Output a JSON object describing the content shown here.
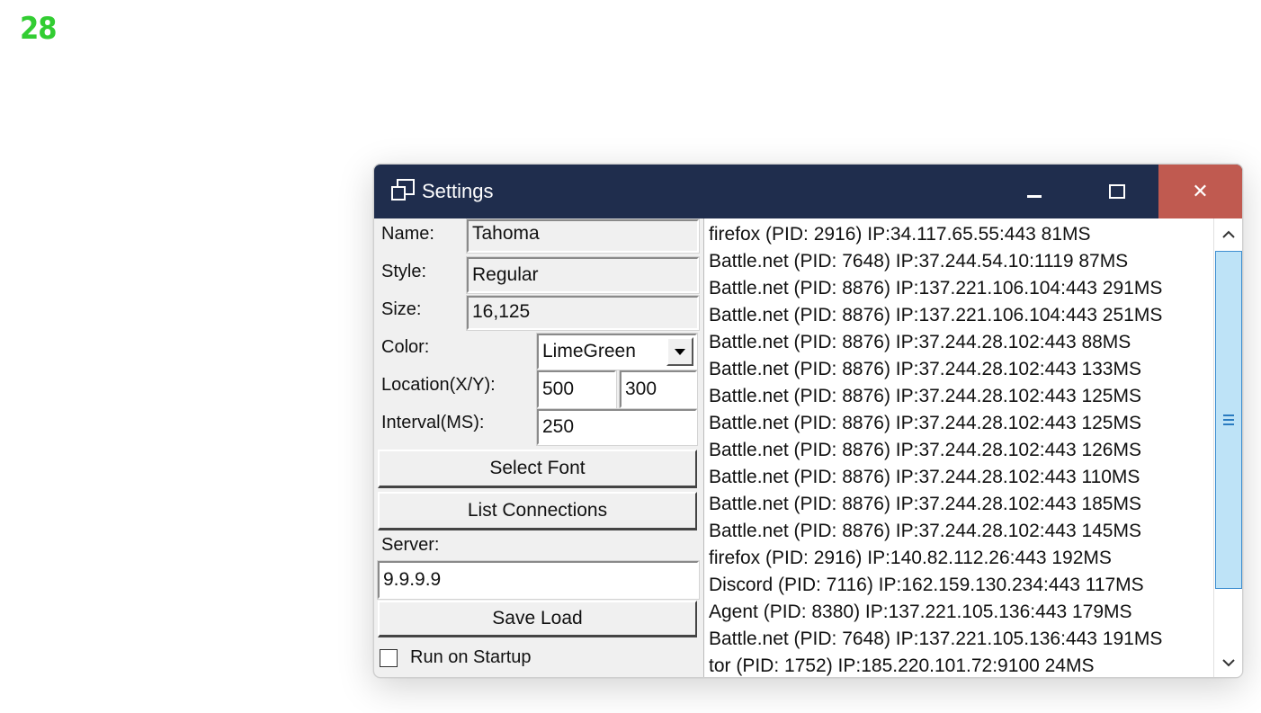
{
  "overlay_value": "28",
  "window": {
    "title": "Settings",
    "controls": {
      "minimize": "minimize-icon",
      "maximize": "maximize-icon",
      "close": "✕"
    }
  },
  "form": {
    "name_label": "Name:",
    "name_value": "Tahoma",
    "style_label": "Style:",
    "style_value": "Regular",
    "size_label": "Size:",
    "size_value": "16,125",
    "color_label": "Color:",
    "color_value": "LimeGreen",
    "location_label": "Location(X/Y):",
    "location_x": "500",
    "location_y": "300",
    "interval_label": "Interval(MS):",
    "interval_value": "250",
    "select_font_button": "Select Font",
    "list_connections_button": "List Connections",
    "server_label": "Server:",
    "server_value": "9.9.9.9",
    "save_load_button": "Save  Load",
    "run_on_startup_label": "Run on Startup",
    "run_on_startup_checked": false
  },
  "connections": [
    "firefox (PID: 2916) IP:34.117.65.55:443 81MS",
    "Battle.net (PID: 7648) IP:37.244.54.10:1119 87MS",
    "Battle.net (PID: 8876) IP:137.221.106.104:443 291MS",
    "Battle.net (PID: 8876) IP:137.221.106.104:443 251MS",
    "Battle.net (PID: 8876) IP:37.244.28.102:443 88MS",
    "Battle.net (PID: 8876) IP:37.244.28.102:443 133MS",
    "Battle.net (PID: 8876) IP:37.244.28.102:443 125MS",
    "Battle.net (PID: 8876) IP:37.244.28.102:443 125MS",
    "Battle.net (PID: 8876) IP:37.244.28.102:443 126MS",
    "Battle.net (PID: 8876) IP:37.244.28.102:443 110MS",
    "Battle.net (PID: 8876) IP:37.244.28.102:443 185MS",
    "Battle.net (PID: 8876) IP:37.244.28.102:443 145MS",
    "firefox (PID: 2916) IP:140.82.112.26:443 192MS",
    "Discord (PID: 7116) IP:162.159.130.234:443 117MS",
    "Agent (PID: 8380) IP:137.221.105.136:443 179MS",
    "Battle.net (PID: 7648) IP:137.221.105.136:443 191MS",
    "tor (PID: 1752) IP:185.220.101.72:9100 24MS"
  ],
  "colors": {
    "overlay_text": "#32cd32",
    "titlebar": "#1f2d4d",
    "close_button": "#c05a50",
    "scroll_thumb": "#bee3f7"
  }
}
